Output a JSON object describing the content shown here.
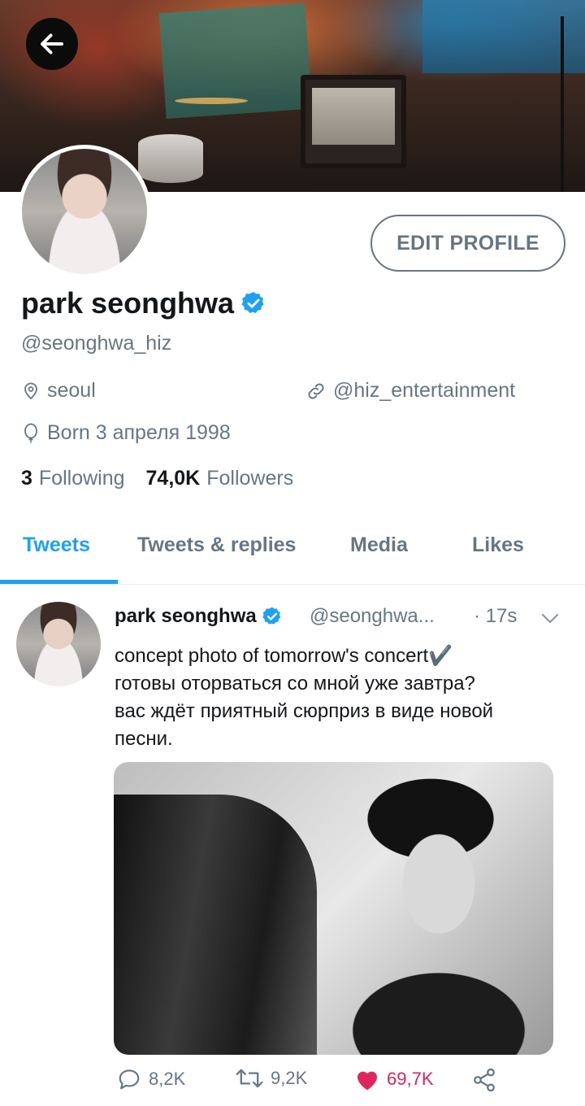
{
  "profile": {
    "name": "park seonghwa",
    "handle": "@seonghwa_hiz",
    "location": "seoul",
    "website": "@hiz_entertainment",
    "born": "Born 3 апреля 1998",
    "edit_label": "EDIT PROFILE"
  },
  "stats": {
    "following_count": "3",
    "following_label": "Following",
    "followers_count": "74,0K",
    "followers_label": "Followers"
  },
  "tabs": [
    {
      "label": "Tweets",
      "active": true
    },
    {
      "label": "Tweets & replies",
      "active": false
    },
    {
      "label": "Media",
      "active": false
    },
    {
      "label": "Likes",
      "active": false
    }
  ],
  "tweet": {
    "name": "park seonghwa",
    "handle": "@seonghwa...",
    "time": "· 17s",
    "text_lines": [
      "concept photo of tomorrow's concert✔️",
      "готовы оторваться со мной уже завтра?",
      "вас ждёт приятный сюрприз в виде новой",
      "песни."
    ],
    "replies": "8,2K",
    "retweets": "9,2K",
    "likes": "69,7K"
  },
  "colors": {
    "accent": "#1da1f2",
    "secondary_text": "#657786",
    "like": "#e0245e"
  },
  "icons": [
    "back-arrow-icon",
    "verified-badge-icon",
    "location-pin-icon",
    "link-icon",
    "birthday-balloon-icon",
    "chevron-down-icon",
    "reply-icon",
    "retweet-icon",
    "heart-icon",
    "share-icon"
  ]
}
